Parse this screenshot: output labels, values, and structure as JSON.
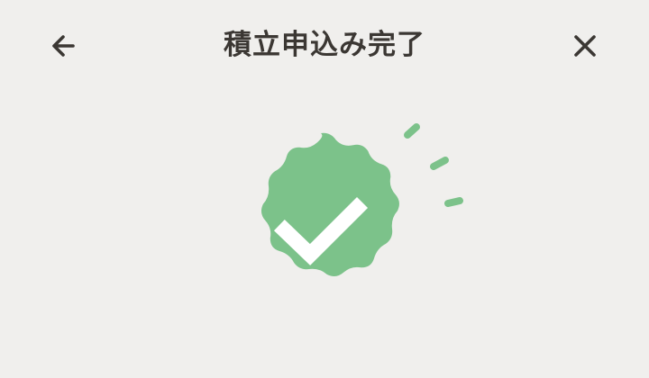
{
  "header": {
    "title": "積立申込み完了",
    "back_icon": "arrow-left-icon",
    "close_icon": "close-icon"
  },
  "success": {
    "icon": "check-badge-icon",
    "sparkle_icon": "sparkle-lines-icon"
  },
  "colors": {
    "background": "#f0efed",
    "text": "#3b3733",
    "accent_green": "#7cc28a",
    "check_white": "#ffffff"
  }
}
